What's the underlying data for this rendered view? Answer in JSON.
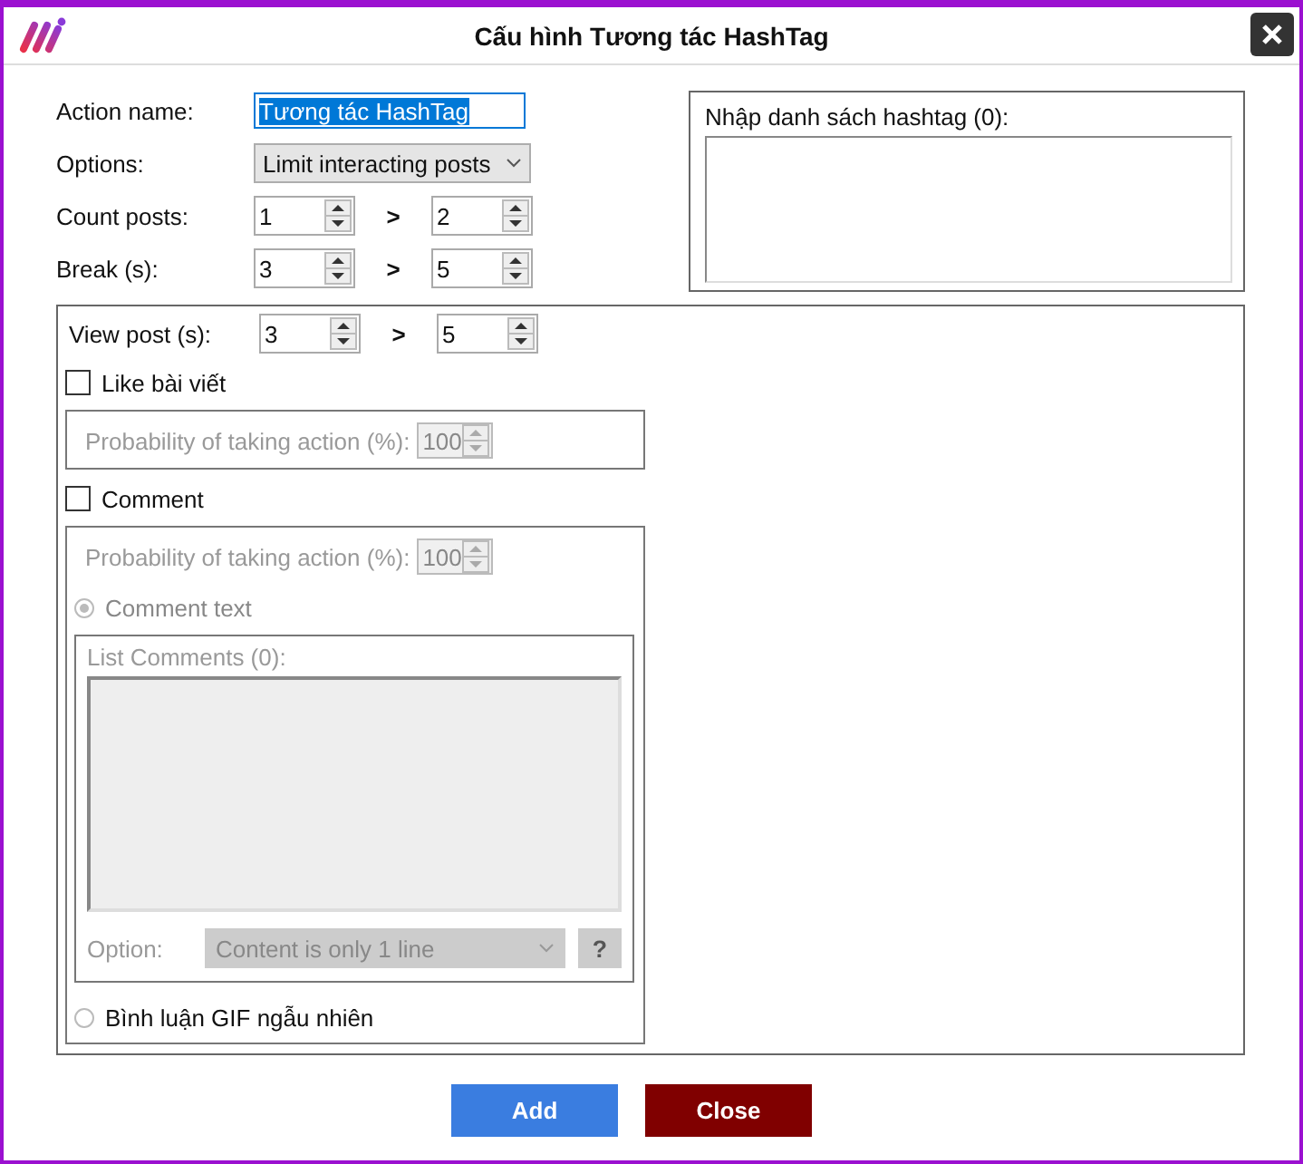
{
  "window": {
    "title": "Cấu hình Tương tác HashTag"
  },
  "action_name": {
    "label": "Action name:",
    "value": "Tương tác HashTag"
  },
  "options": {
    "label": "Options:",
    "value": "Limit interacting posts"
  },
  "count_posts": {
    "label": "Count posts:",
    "from": "1",
    "separator": ">",
    "to": "2"
  },
  "break": {
    "label": "Break (s):",
    "from": "3",
    "separator": ">",
    "to": "5"
  },
  "hashtag_list": {
    "label": "Nhập danh sách hashtag (0):"
  },
  "view_post": {
    "label": "View post (s):",
    "from": "3",
    "separator": ">",
    "to": "5"
  },
  "like": {
    "label": "Like bài viết",
    "checked": false,
    "probability_label": "Probability of taking action (%):",
    "probability": "100"
  },
  "comment": {
    "label": "Comment",
    "checked": false,
    "probability_label": "Probability of taking action (%):",
    "probability": "100",
    "modes": [
      {
        "label": "Comment text",
        "selected": true
      },
      {
        "label": "Bình luận GIF ngẫu nhiên",
        "selected": false
      }
    ],
    "list_label": "List Comments (0):",
    "option_label": "Option:",
    "option_value": "Content is only 1 line",
    "help": "?"
  },
  "buttons": [
    {
      "label": "Add",
      "kind": "primary"
    },
    {
      "label": "Close",
      "kind": "danger"
    }
  ]
}
